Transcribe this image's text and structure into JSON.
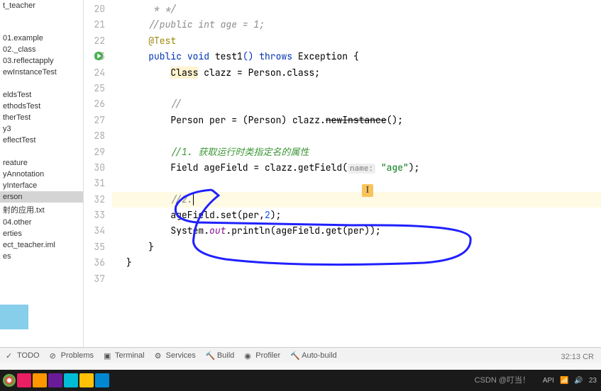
{
  "sidebar": {
    "items": [
      {
        "label": "t_teacher"
      },
      {
        "label": "01.example"
      },
      {
        "label": "02._class"
      },
      {
        "label": "03.reflectapply"
      },
      {
        "label": "ewInstanceTest"
      },
      {
        "label": "eldsTest"
      },
      {
        "label": "ethodsTest"
      },
      {
        "label": "therTest"
      },
      {
        "label": "y3"
      },
      {
        "label": "eflectTest"
      },
      {
        "label": "reature"
      },
      {
        "label": "yAnnotation"
      },
      {
        "label": "yInterface"
      },
      {
        "label": "erson",
        "selected": true
      },
      {
        "label": "射的应用.txt"
      },
      {
        "label": "04.other"
      },
      {
        "label": "erties"
      },
      {
        "label": "ect_teacher.iml"
      },
      {
        "label": "es"
      }
    ]
  },
  "gutter": {
    "start": 20,
    "end": 37,
    "run_at": 23
  },
  "code": {
    "l20": "     * */",
    "l21_comment": "//public int age = 1;",
    "l22_anno": "@Test",
    "l23_public": "public",
    "l23_void": " void",
    "l23_method": " test1",
    "l23_throws": "() throws",
    "l23_exc": " Exception {",
    "l24_class": "Class",
    "l24_rest": " clazz = Person.class;",
    "l26_comment": "//",
    "l27_a": "Person per = (Person) clazz.",
    "l27_strike": "newInstance",
    "l27_c": "();",
    "l29_comment": "//1. 获取运行时类指定名的属性",
    "l30_a": "Field ageField = clazz.getField(",
    "l30_hint": "name:",
    "l30_str": " \"age\"",
    "l30_c": ");",
    "l32_comment": "//2.",
    "l33_a": "ageField.set(per,",
    "l33_num": "2",
    "l33_c": ");",
    "l34_a": "System.",
    "l34_out": "out",
    "l34_b": ".println(ageField.get(per));",
    "l35": "    }",
    "l36": "}"
  },
  "toolbar": {
    "items": [
      {
        "icon": "todo",
        "label": "TODO"
      },
      {
        "icon": "problems",
        "label": "Problems"
      },
      {
        "icon": "terminal",
        "label": "Terminal"
      },
      {
        "icon": "services",
        "label": "Services"
      },
      {
        "icon": "build",
        "label": "Build"
      },
      {
        "icon": "profiler",
        "label": "Profiler"
      },
      {
        "icon": "autobuild",
        "label": "Auto-build"
      }
    ]
  },
  "status": {
    "right": "32:13   CR",
    "api": "API"
  },
  "watermark": "CSDN @叮当！",
  "taskbar": {
    "time": "23",
    "icons_count": 6
  }
}
